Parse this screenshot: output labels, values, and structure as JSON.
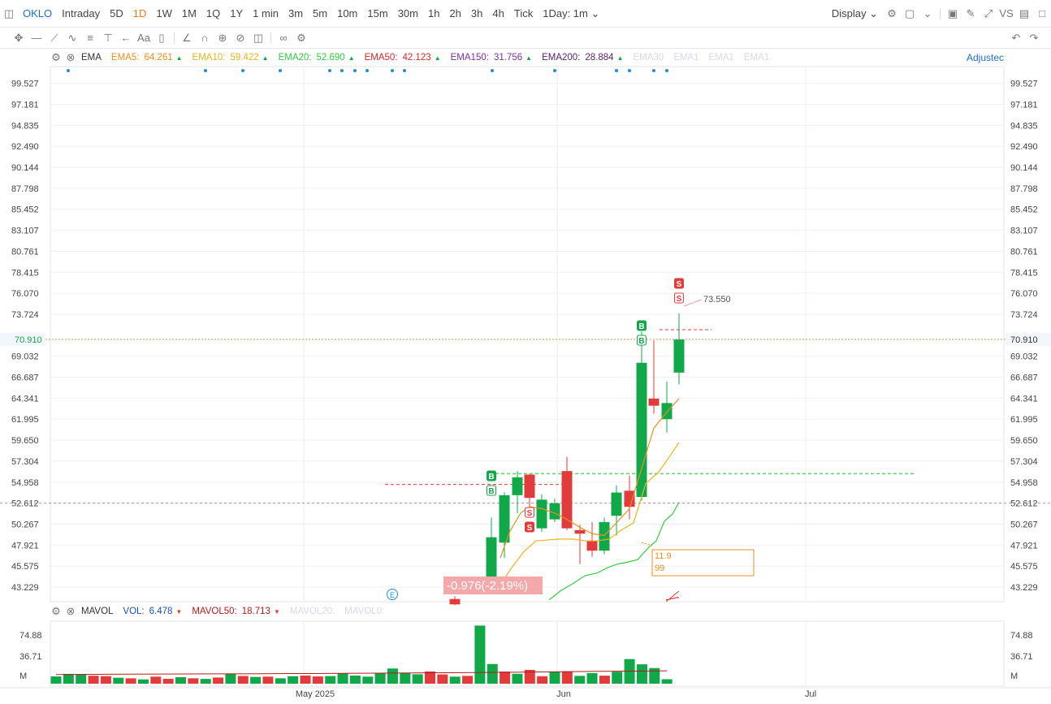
{
  "header": {
    "ticker": "OKLO",
    "periods": [
      "Intraday",
      "5D",
      "1D",
      "1W",
      "1M",
      "1Q",
      "1Y",
      "1 min",
      "3m",
      "5m",
      "10m",
      "15m",
      "30m",
      "1h",
      "2h",
      "3h",
      "4h",
      "Tick"
    ],
    "active_period": "1D",
    "interval_select": "1Day: 1m",
    "display_label": "Display"
  },
  "toolbar_icons": [
    "move-icon",
    "line-tool-icon",
    "trend-tool-icon",
    "wave-tool-icon",
    "fib-tool-icon",
    "measure-tool-icon",
    "arrow-tool-icon",
    "text-tool-icon",
    "note-tool-icon",
    "pen-tool-icon",
    "magnet-icon",
    "lock-icon",
    "hide-icon",
    "trash-icon",
    "link-icon",
    "settings-icon"
  ],
  "ema_legend": {
    "indicator": "EMA",
    "items": [
      {
        "label": "EMA5:",
        "value": "64.261",
        "color": "#e8911c"
      },
      {
        "label": "EMA10:",
        "value": "59.422",
        "color": "#e8b41c"
      },
      {
        "label": "EMA20:",
        "value": "52.690",
        "color": "#2fcc42"
      },
      {
        "label": "EMA50:",
        "value": "42.123",
        "color": "#d42a2a"
      },
      {
        "label": "EMA150:",
        "value": "31.756",
        "color": "#7b2fa0"
      },
      {
        "label": "EMA200:",
        "value": "28.884",
        "color": "#5a1f6e"
      }
    ],
    "faded": [
      "EMA30",
      "EMA1",
      "EMA1",
      "EMA1"
    ],
    "adjusted_label": "Adjustec"
  },
  "mavol_legend": {
    "indicator": "MAVOL",
    "items": [
      {
        "label": "VOL:",
        "value": "6.478",
        "color": "#1a4fb4"
      },
      {
        "label": "MAVOL50:",
        "value": "18.713",
        "color": "#b41a1a"
      }
    ],
    "faded": [
      "MAVOL20:",
      "MAVOL0:"
    ]
  },
  "chart_data": {
    "type": "candlestick",
    "price_ticks": [
      "99.527",
      "97.181",
      "94.835",
      "92.490",
      "90.144",
      "87.798",
      "85.452",
      "83.107",
      "80.761",
      "78.415",
      "76.070",
      "73.724",
      "70.910",
      "69.032",
      "66.687",
      "64.341",
      "61.995",
      "59.650",
      "57.304",
      "54.958",
      "52.612",
      "50.267",
      "47.921",
      "45.575",
      "43.229"
    ],
    "ylim": [
      41.6,
      101.4
    ],
    "current_price": "70.910",
    "high_label": "73.550",
    "change_label": "-0.976(-2.19%)",
    "box_label_1": "11.9",
    "box_label_2": "99",
    "x_labels": [
      "May 2025",
      "Jun",
      "Jul"
    ],
    "volume_ticks": [
      "74.88",
      "36.71",
      "M"
    ],
    "candles": [
      {
        "o": 41.9,
        "h": 42.2,
        "l": 41.2,
        "c": 41.3
      },
      {
        "o": 43.0,
        "h": 51.0,
        "l": 42.8,
        "c": 48.8
      },
      {
        "o": 48.2,
        "h": 53.8,
        "l": 46.5,
        "c": 53.5
      },
      {
        "o": 53.5,
        "h": 56.2,
        "l": 51.5,
        "c": 55.5
      },
      {
        "o": 55.8,
        "h": 55.9,
        "l": 51.8,
        "c": 53.2
      },
      {
        "o": 49.8,
        "h": 53.6,
        "l": 49.4,
        "c": 53.0
      },
      {
        "o": 50.8,
        "h": 53.1,
        "l": 50.5,
        "c": 52.6
      },
      {
        "o": 56.2,
        "h": 57.8,
        "l": 49.6,
        "c": 49.8
      },
      {
        "o": 49.6,
        "h": 50.2,
        "l": 45.8,
        "c": 49.2
      },
      {
        "o": 48.4,
        "h": 50.5,
        "l": 46.6,
        "c": 47.3
      },
      {
        "o": 47.3,
        "h": 51.0,
        "l": 46.9,
        "c": 50.5
      },
      {
        "o": 51.2,
        "h": 54.6,
        "l": 49.0,
        "c": 53.8
      },
      {
        "o": 54.0,
        "h": 55.7,
        "l": 50.8,
        "c": 52.2
      },
      {
        "o": 53.3,
        "h": 71.8,
        "l": 52.9,
        "c": 68.3
      },
      {
        "o": 64.3,
        "h": 70.8,
        "l": 62.6,
        "c": 63.5
      },
      {
        "o": 62.0,
        "h": 66.2,
        "l": 60.5,
        "c": 63.8
      },
      {
        "o": 67.2,
        "h": 73.8,
        "l": 65.9,
        "c": 70.9
      }
    ],
    "ema5": [
      46.5,
      49.5,
      51.5,
      52.2,
      52.0,
      51.5,
      50.8,
      49.9,
      49.2,
      49.0,
      50.4,
      52.0,
      56.5,
      61.0,
      62.8,
      64.3
    ],
    "ema10": [
      43.0,
      45.4,
      47.2,
      48.4,
      48.5,
      48.6,
      48.6,
      48.4,
      48.4,
      48.6,
      49.6,
      50.4,
      54.8,
      56.0,
      57.5,
      59.4
    ],
    "ema20": [
      41.8,
      42.8,
      43.6,
      44.5,
      44.8,
      45.4,
      45.8,
      46.0,
      46.3,
      47.0,
      47.8,
      48.4,
      50.6,
      51.4,
      52.7
    ],
    "ema50": [
      41.8,
      42.1
    ],
    "volume": [
      10.5,
      14.2,
      13.8,
      11.5,
      10.9,
      8.6,
      7.8,
      6.2,
      10.2,
      7.1,
      9.4,
      7.8,
      6.9,
      8.9,
      14.5,
      11.2,
      9.8,
      10.2,
      7.8,
      10.8,
      11.8,
      10.5,
      11.0,
      15.4,
      11.8,
      10.2,
      15.8,
      22.0,
      15.3,
      13.6,
      17.7,
      13.4,
      10.2,
      11.3,
      84.0,
      28.5,
      17.5,
      14.3,
      20.0,
      10.8,
      17.6,
      17.9,
      11.3,
      15.3,
      11.6,
      17.3,
      35.6,
      28.0,
      22.6,
      6.5
    ],
    "volume_up": [
      true,
      true,
      true,
      false,
      false,
      true,
      false,
      true,
      false,
      false,
      true,
      false,
      true,
      false,
      true,
      false,
      true,
      false,
      true,
      true,
      false,
      false,
      true,
      true,
      true,
      true,
      true,
      true,
      true,
      true,
      false,
      false,
      true,
      false,
      true,
      true,
      false,
      true,
      false,
      false,
      true,
      false,
      true,
      true,
      false,
      true,
      true,
      true,
      true,
      true
    ],
    "mavol50": [
      13.2,
      13.5,
      13.8,
      14.0,
      14.1,
      14.3,
      14.4,
      14.6,
      14.8,
      15.1,
      15.4,
      15.7,
      16.0,
      16.4,
      16.8,
      17.3,
      17.9,
      18.2,
      18.7
    ],
    "annotations": {
      "buy": [
        "B",
        "B",
        "B",
        "B"
      ],
      "sell": [
        "S",
        "S",
        "S",
        "S"
      ],
      "earnings": "E"
    }
  }
}
